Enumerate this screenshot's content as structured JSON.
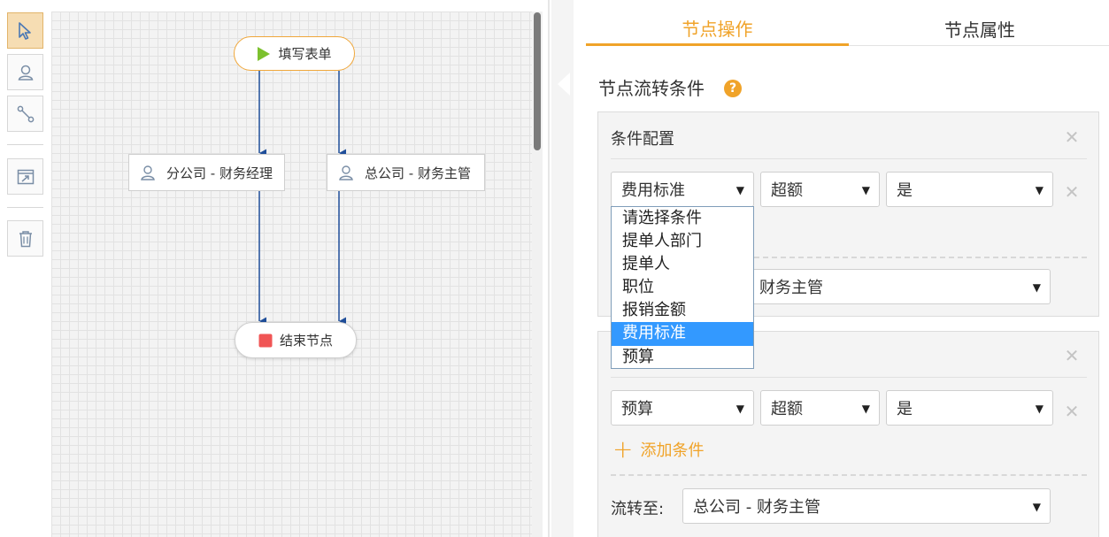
{
  "canvas": {
    "nodes": {
      "start": "填写表单",
      "branch_manager": "分公司 - 财务经理",
      "hq_supervisor": "总公司 - 财务主管",
      "end": "结束节点"
    }
  },
  "panel": {
    "tabs": {
      "operations": "节点操作",
      "properties": "节点属性"
    },
    "section_title": "节点流转条件",
    "help_icon": "?",
    "close_symbol": "✕",
    "arrow": "▼",
    "card1": {
      "title": "条件配置",
      "condition": {
        "field": "费用标准",
        "operator": "超额",
        "value": "是"
      },
      "flow_to_partial": "财务主管",
      "dropdown_options": [
        "请选择条件",
        "提单人部门",
        "提单人",
        "职位",
        "报销金额",
        "费用标准",
        "预算"
      ],
      "dropdown_selected": "费用标准"
    },
    "card2": {
      "condition": {
        "field": "预算",
        "operator": "超额",
        "value": "是"
      },
      "add_condition": "添加条件",
      "flow_to_label": "流转至:",
      "flow_to_value": "总公司 - 财务主管"
    }
  },
  "colors": {
    "accent": "#f0a329",
    "selected": "#3399ff",
    "start_play": "#7cc12e",
    "end_stop": "#f05555"
  }
}
